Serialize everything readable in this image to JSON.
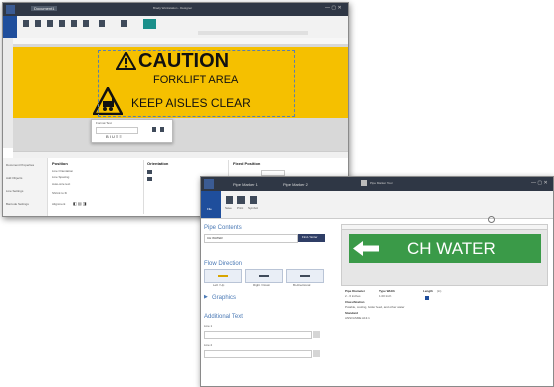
{
  "win1": {
    "title": "Brady Workstation - Designer",
    "tab": "Document1",
    "sign": {
      "line1": "CAUTION",
      "line2": "FORKLIFT AREA",
      "line3": "KEEP AISLES CLEAR"
    },
    "popup_label": "Format Text",
    "panels": {
      "left": [
        "Document Properties",
        "Add Objects",
        "Line Settings",
        "Barcode Settings"
      ],
      "mid_title": "Position",
      "mid_title2": "Orientation",
      "right_title": "Fixed Position",
      "mid_lines": [
        "Line Orientation",
        "Line Spacing",
        "Auto-size text",
        "Shrink to fit",
        "Alignment"
      ]
    }
  },
  "win2": {
    "title": "Pipe Marker Tool",
    "tabs": [
      "Pipe Marker 1",
      "Pipe Marker 2"
    ],
    "ribbon": [
      "File",
      "Save",
      "Print",
      "Symbol"
    ],
    "pipe_contents_label": "Pipe Contents",
    "pipe_contents_value": "CH WATER",
    "pipe_button": "Find / Enter",
    "flow_direction_label": "Flow Direction",
    "flow_options": [
      "Left / Up",
      "Right / Down",
      "Bi-directional"
    ],
    "graphics_label": "Graphics",
    "additional_text_label": "Additional Text",
    "line_labels": [
      "Line 1",
      "Line 2"
    ],
    "marker_text": "CH WATER",
    "info": {
      "pipe_diameter_label": "Pipe Diameter",
      "pipe_diameter_value": "2 - 6 inches",
      "type_width_label": "Type Width",
      "type_width_value": "1.00 Inch",
      "classification_label": "Classification",
      "classification_value": "Potable, cooling, boiler feed, and other water",
      "standard_label": "Standard",
      "standard_value": "ANSI/ASME A13.1",
      "length_label": "Length",
      "length_value": "(in)"
    },
    "colors": {
      "marker_green": "#3a9a48",
      "sign_yellow": "#f5c000"
    }
  }
}
